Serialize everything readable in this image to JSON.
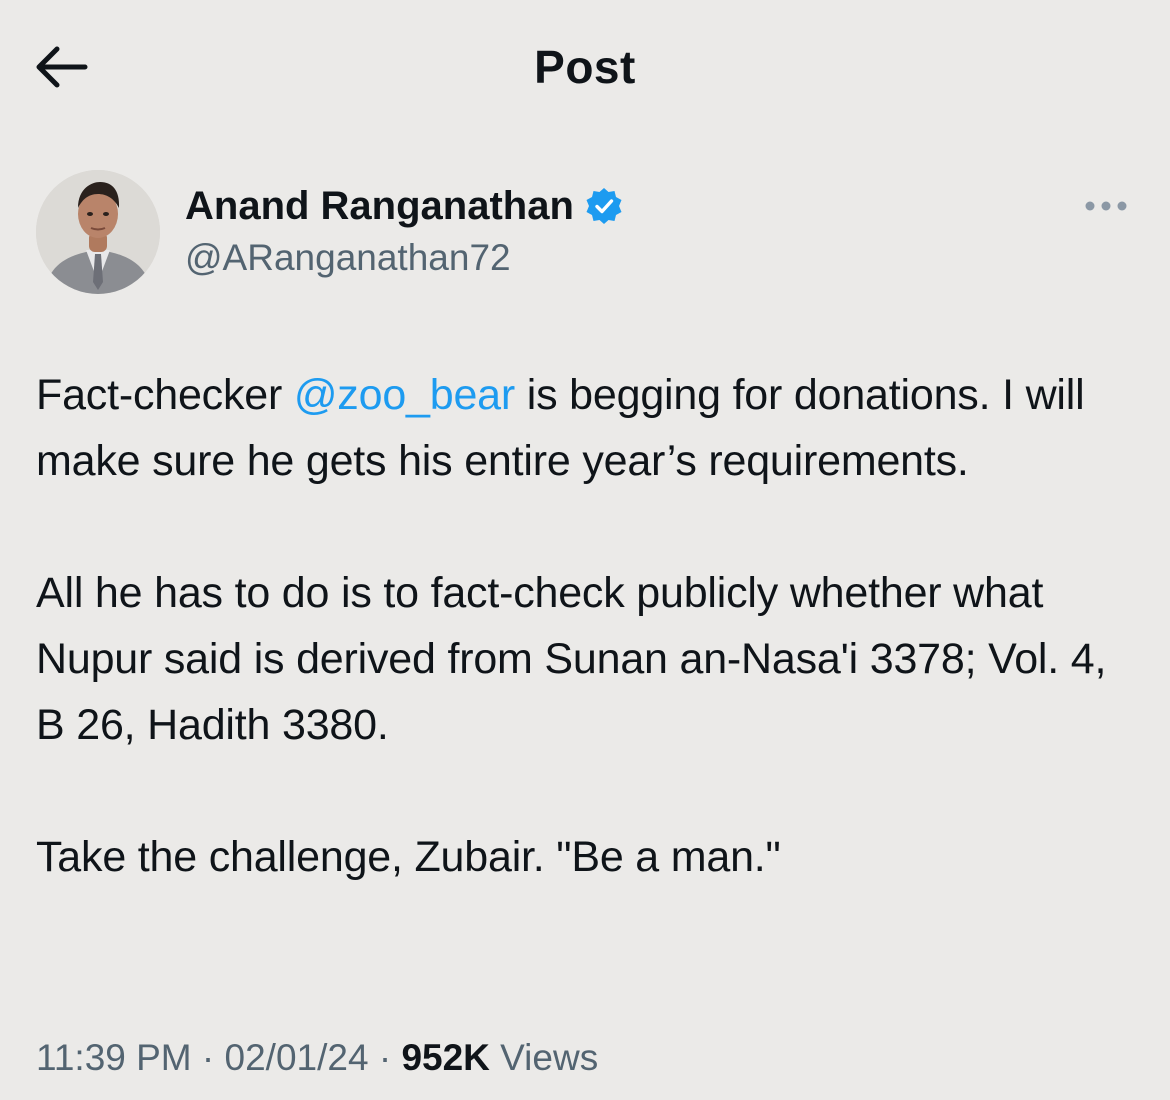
{
  "header": {
    "title": "Post"
  },
  "author": {
    "name": "Anand Ranganathan",
    "handle": "@ARanganathan72",
    "verified": true
  },
  "tweet": {
    "p1_before": "Fact-checker ",
    "p1_mention": "@zoo_bear",
    "p1_after": " is begging for donations. I will make sure he gets his entire year’s requirements.",
    "p2": "All he has to do is to fact-check publicly whether what Nupur said is derived from Sunan an-Nasa'i 3378; Vol. 4, B 26, Hadith 3380.",
    "p3": "Take the challenge, Zubair. \"Be a man.\""
  },
  "meta": {
    "time": "11:39 PM",
    "sep1": " · ",
    "date": "02/01/24",
    "sep2": " · ",
    "views_count": "952K",
    "views_label": " Views"
  },
  "colors": {
    "background": "#ebeae8",
    "text": "#0f1419",
    "secondary": "#536471",
    "accent": "#1d9bf0"
  },
  "icons": {
    "back": "arrow-left-icon",
    "verified": "verified-badge-icon",
    "more": "more-horizontal-icon"
  }
}
